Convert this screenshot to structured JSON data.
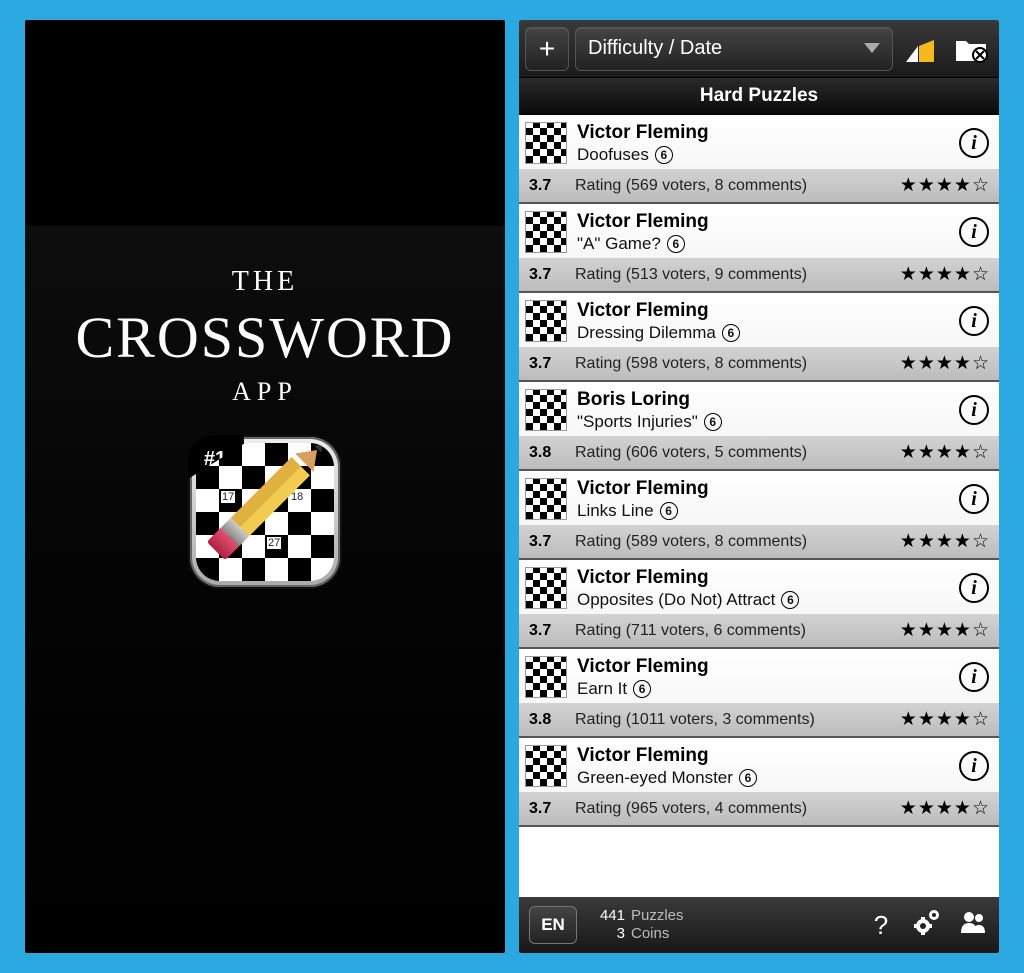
{
  "splash": {
    "line1": "THE",
    "line2": "CROSSWORD",
    "line3": "APP",
    "badge": "#1",
    "grid_nums": [
      "17",
      "18",
      "27"
    ]
  },
  "topbar": {
    "sort_label": "Difficulty / Date"
  },
  "section_header": "Hard Puzzles",
  "puzzles": [
    {
      "author": "Victor Fleming",
      "title": "Doofuses",
      "cost": "6",
      "score": "3.7",
      "voters": 569,
      "comments": 8,
      "stars": 4
    },
    {
      "author": "Victor Fleming",
      "title": "\"A\" Game?",
      "cost": "6",
      "score": "3.7",
      "voters": 513,
      "comments": 9,
      "stars": 4
    },
    {
      "author": "Victor Fleming",
      "title": "Dressing Dilemma",
      "cost": "6",
      "score": "3.7",
      "voters": 598,
      "comments": 8,
      "stars": 4
    },
    {
      "author": "Boris Loring",
      "title": "\"Sports Injuries\"",
      "cost": "6",
      "score": "3.8",
      "voters": 606,
      "comments": 5,
      "stars": 4
    },
    {
      "author": "Victor Fleming",
      "title": "Links Line",
      "cost": "6",
      "score": "3.7",
      "voters": 589,
      "comments": 8,
      "stars": 4
    },
    {
      "author": "Victor Fleming",
      "title": "Opposites (Do Not) Attract",
      "cost": "6",
      "score": "3.7",
      "voters": 711,
      "comments": 6,
      "stars": 4
    },
    {
      "author": "Victor Fleming",
      "title": "Earn It",
      "cost": "6",
      "score": "3.8",
      "voters": 1011,
      "comments": 3,
      "stars": 4
    },
    {
      "author": "Victor Fleming",
      "title": "Green-eyed Monster",
      "cost": "6",
      "score": "3.7",
      "voters": 965,
      "comments": 4,
      "stars": 4
    }
  ],
  "bottombar": {
    "lang": "EN",
    "puzzles_count": 441,
    "puzzles_label": "Puzzles",
    "coins_count": 3,
    "coins_label": "Coins"
  }
}
